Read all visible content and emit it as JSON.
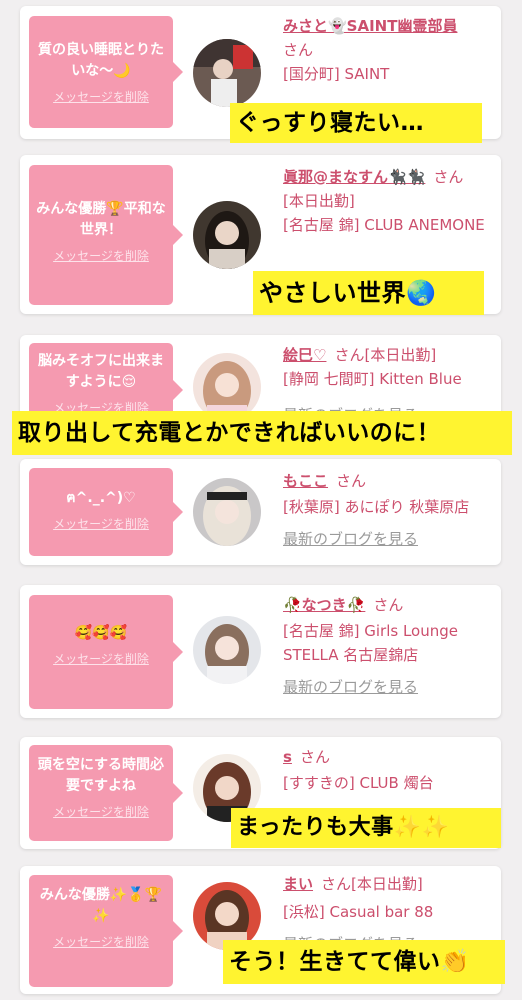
{
  "cards": [
    {
      "message": "質の良い睡眠とりたいな〜🌙",
      "delete": "メッセージを削除",
      "name": "みさと👻SAINT幽霊部員",
      "suffix": "さん",
      "lines": [
        "[国分町] SAINT"
      ],
      "blog": ""
    },
    {
      "message": "みんな優勝🏆平和な世界！",
      "delete": "メッセージを削除",
      "name": "眞那@まなすん🐈‍⬛🐈‍⬛",
      "suffix": "さん",
      "lines": [
        "[本日出勤]",
        "[名古屋 錦] CLUB ANEMONE"
      ],
      "blog": ""
    },
    {
      "message": "脳みそオフに出来ますように😌",
      "delete": "メッセージを削除",
      "name": "絵巳♡",
      "suffix": "さん",
      "lines": [
        "[本日出勤]",
        "[静岡 七間町] Kitten Blue"
      ],
      "blog": "最新のブログを見る"
    },
    {
      "message": "ฅ^._.^)♡",
      "delete": "メッセージを削除",
      "name": "もここ",
      "suffix": "さん",
      "lines": [
        "[秋葉原] あにぽり 秋葉原店"
      ],
      "blog": "最新のブログを見る"
    },
    {
      "message": "🥰🥰🥰",
      "delete": "メッセージを削除",
      "name": "🥀なつき🥀",
      "suffix": "さん",
      "lines": [
        "[名古屋 錦] Girls Lounge STELLA 名古屋錦店"
      ],
      "blog": "最新のブログを見る"
    },
    {
      "message": "頭を空にする時間必要ですよね",
      "delete": "メッセージを削除",
      "name": "s",
      "suffix": "さん",
      "lines": [
        "[すすきの] CLUB 燭台"
      ],
      "blog": ""
    },
    {
      "message": "みんな優勝✨🥇🏆✨",
      "delete": "メッセージを削除",
      "name": "まい",
      "suffix": "さん",
      "lines": [
        "[本日出勤]",
        "[浜松] Casual bar 88"
      ],
      "blog": "最新のブログを見る"
    }
  ],
  "captions": [
    "ぐっすり寝たい…",
    "やさしい世界🌏",
    "取り出して充電とかできればいいのに！",
    "まったりも大事✨✨",
    "そう！生きてて偉い👏"
  ],
  "colors": {
    "accent": "#cc4f6d",
    "bubble": "#f59ab0",
    "caption_bg": "#fff430",
    "page_bg": "#f1eff0"
  }
}
